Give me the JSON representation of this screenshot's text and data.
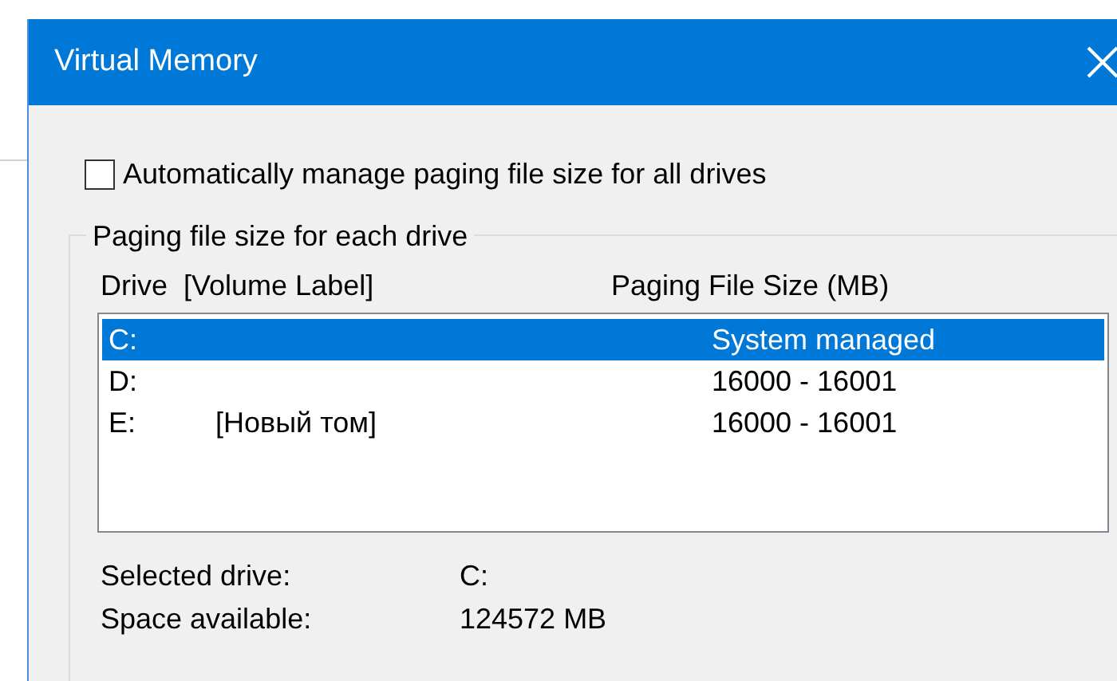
{
  "window": {
    "title": "Virtual Memory"
  },
  "auto_manage": {
    "label": "Automatically manage paging file size for all drives",
    "checked": false
  },
  "group": {
    "title": "Paging file size for each drive",
    "columns": [
      "Drive  [Volume Label]",
      "Paging File Size (MB)"
    ],
    "rows": [
      {
        "drive": "C:",
        "size": "System managed",
        "selected": true
      },
      {
        "drive": "D:",
        "size": "16000 - 16001",
        "selected": false
      },
      {
        "drive": "E:",
        "label": "[Новый том]",
        "size": "16000 - 16001",
        "selected": false
      }
    ],
    "details": [
      {
        "label": "Selected drive:",
        "value": "C:"
      },
      {
        "label": "Space available:",
        "value": "124572 MB"
      }
    ]
  }
}
